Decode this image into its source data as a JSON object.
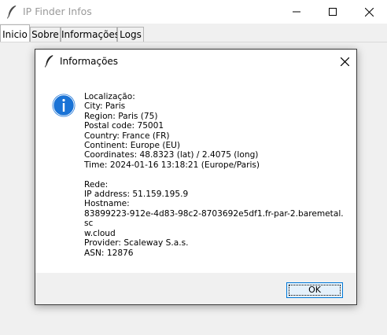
{
  "window": {
    "title": "IP Finder Infos"
  },
  "tabs": [
    {
      "label": "Inicio"
    },
    {
      "label": "Sobre"
    },
    {
      "label": "Informações"
    },
    {
      "label": "Logs"
    }
  ],
  "dialog": {
    "title": "Informações",
    "message": "Localização:\nCity: Paris\nRegion: Paris (75)\nPostal code: 75001\nCountry: France (FR)\nContinent: Europe (EU)\nCoordinates: 48.8323 (lat) / 2.4075 (long)\nTime: 2024-01-16 13:18:21 (Europe/Paris)\n\nRede:\nIP address: 51.159.195.9\nHostname:\n83899223-912e-4d83-98c2-8703692e5df1.fr-par-2.baremetal.sc\nw.cloud\nProvider: Scaleway S.a.s.\nASN: 12876",
    "ok_label": "OK"
  },
  "colors": {
    "accent": "#0078d7",
    "info_icon": "#1a73d6"
  }
}
